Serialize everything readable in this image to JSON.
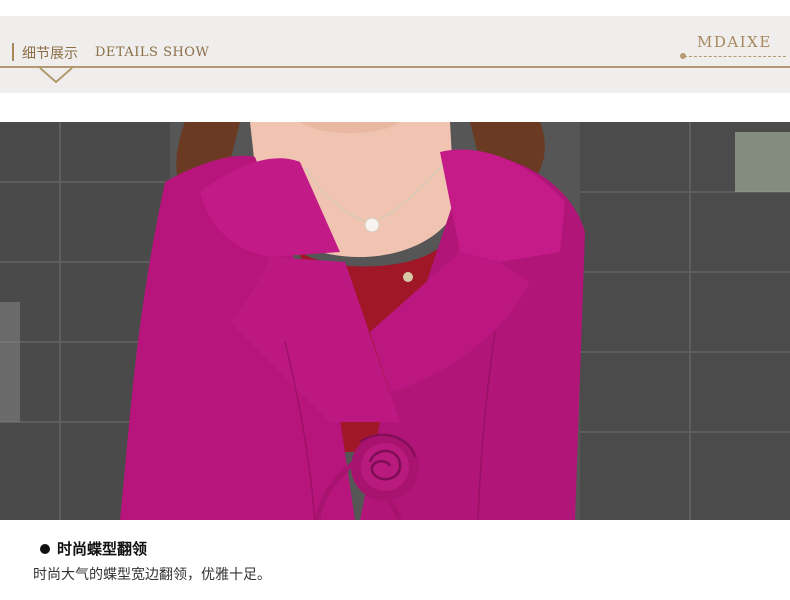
{
  "header": {
    "title_cn": "细节展示",
    "title_en": "DETAILS SHOW",
    "brand": "MDAIXE",
    "accent_color": "#b39a70"
  },
  "photo": {
    "subject": "magenta-wool-coat-collar-detail"
  },
  "caption": {
    "title": "时尚蝶型翻领",
    "body": "时尚大气的蝶型宽边翻领，优雅十足。"
  }
}
